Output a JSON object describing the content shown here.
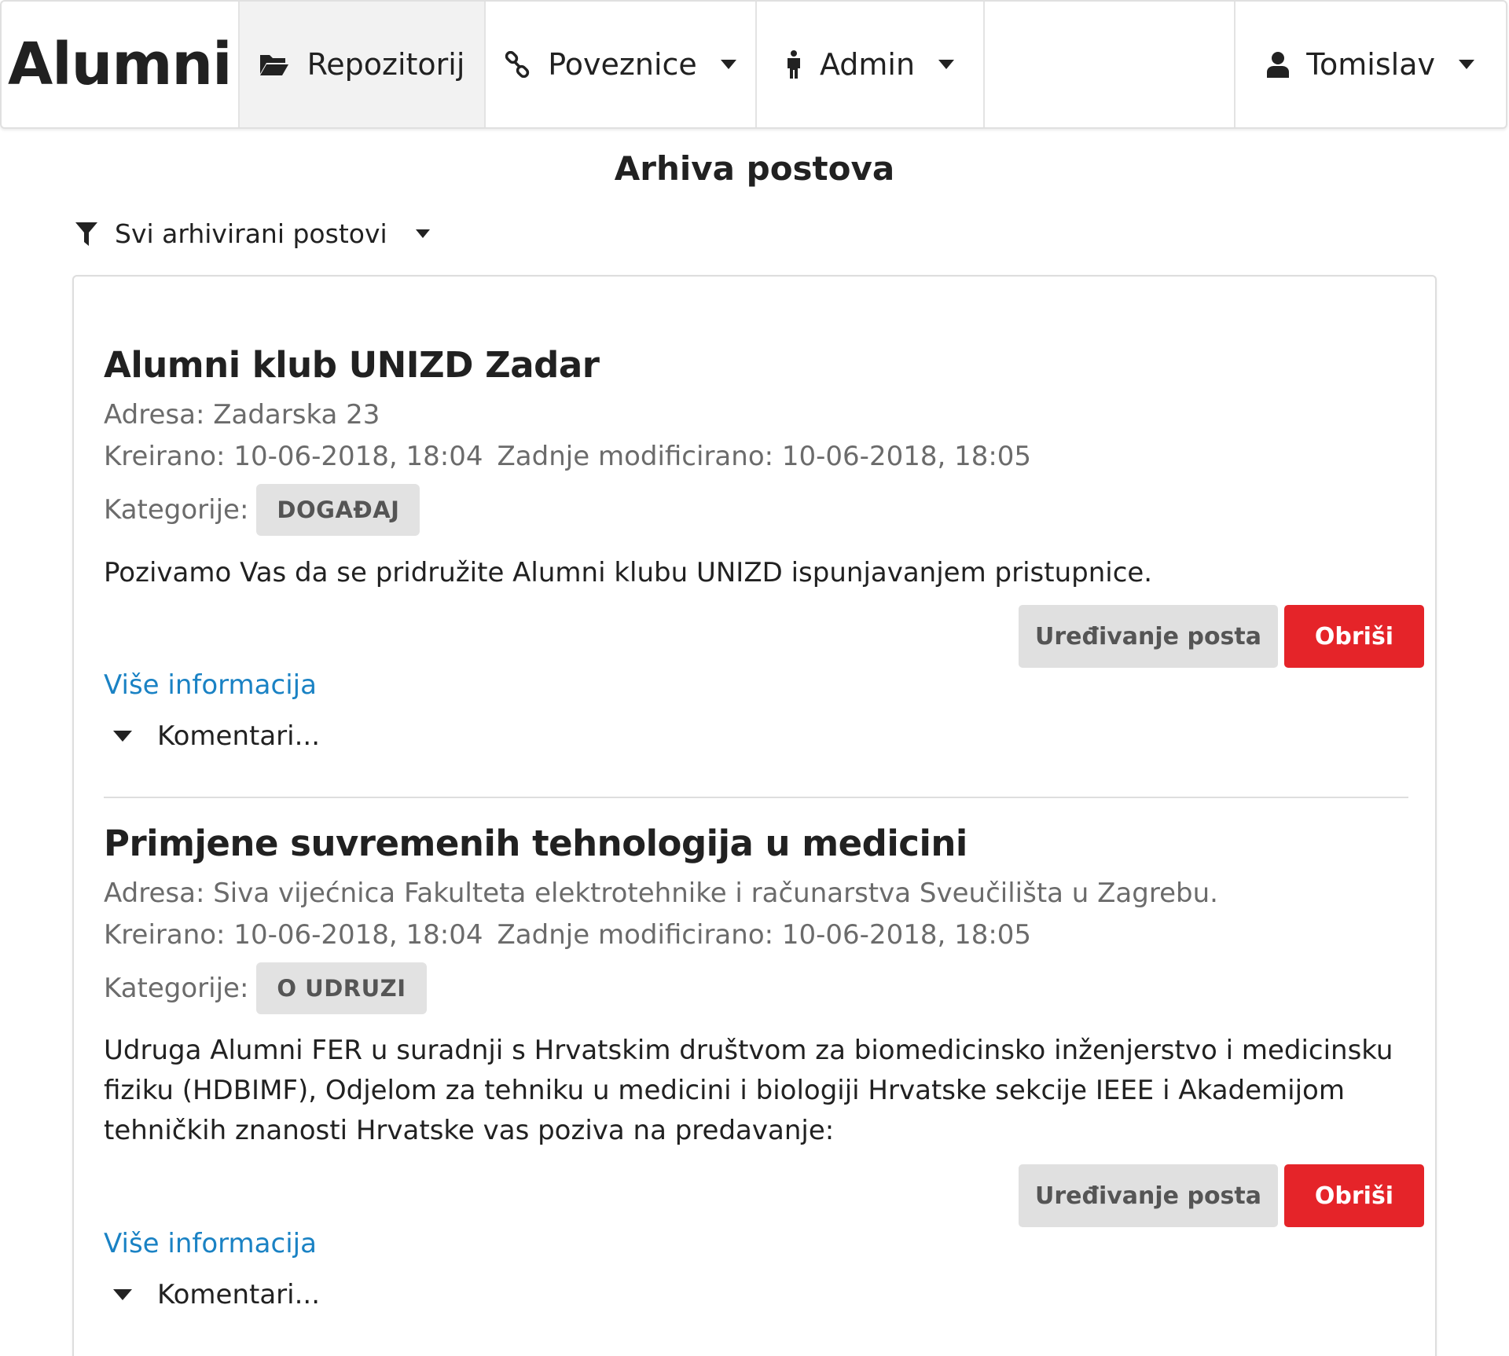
{
  "navbar": {
    "brand": "Alumni",
    "items": [
      {
        "label": "Repozitorij",
        "icon": "folder-open-icon",
        "active": true
      },
      {
        "label": "Poveznice",
        "icon": "link-icon",
        "dropdown": true
      },
      {
        "label": "Admin",
        "icon": "male-figure-icon",
        "dropdown": true
      }
    ],
    "user": {
      "label": "Tomislav",
      "icon": "user-icon",
      "dropdown": true
    }
  },
  "page": {
    "title": "Arhiva postova",
    "filter": {
      "label": "Svi arhivirani postovi",
      "icon": "filter-icon"
    }
  },
  "posts": [
    {
      "title": "Alumni klub UNIZD Zadar",
      "address": "Adresa: Zadarska 23",
      "created": "Kreirano: 10-06-2018, 18:04",
      "modified": "Zadnje modificirano: 10-06-2018, 18:05",
      "categories_label": "Kategorije:",
      "category": "DOGAĐAJ",
      "body": "Pozivamo Vas da se pridružite Alumni klubu UNIZD ispunjavanjem pristupnice.",
      "edit_label": "Uređivanje posta",
      "delete_label": "Obriši",
      "more_label": "Više informacija",
      "comments_label": "Komentari..."
    },
    {
      "title": "Primjene suvremenih tehnologija u medicini",
      "address": "Adresa: Siva vijećnica Fakulteta elektrotehnike i računarstva Sveučilišta u Zagrebu.",
      "created": "Kreirano: 10-06-2018, 18:04",
      "modified": "Zadnje modificirano: 10-06-2018, 18:05",
      "categories_label": "Kategorije:",
      "category": "O UDRUZI",
      "body": "Udruga Alumni FER u suradnji s Hrvatskim društvom za biomedicinsko inženjerstvo i medicinsku fiziku (HDBIMF), Odjelom za tehniku u medicini i biologiji Hrvatske sekcije IEEE i Akademijom tehničkih znanosti Hrvatske vas poziva na predavanje:",
      "edit_label": "Uređivanje posta",
      "delete_label": "Obriši",
      "more_label": "Više informacija",
      "comments_label": "Komentari..."
    }
  ],
  "colors": {
    "delete": "#e52429",
    "link": "#1a82c4",
    "badge_bg": "#e2e2e2",
    "active_nav": "#f2f2f2"
  }
}
